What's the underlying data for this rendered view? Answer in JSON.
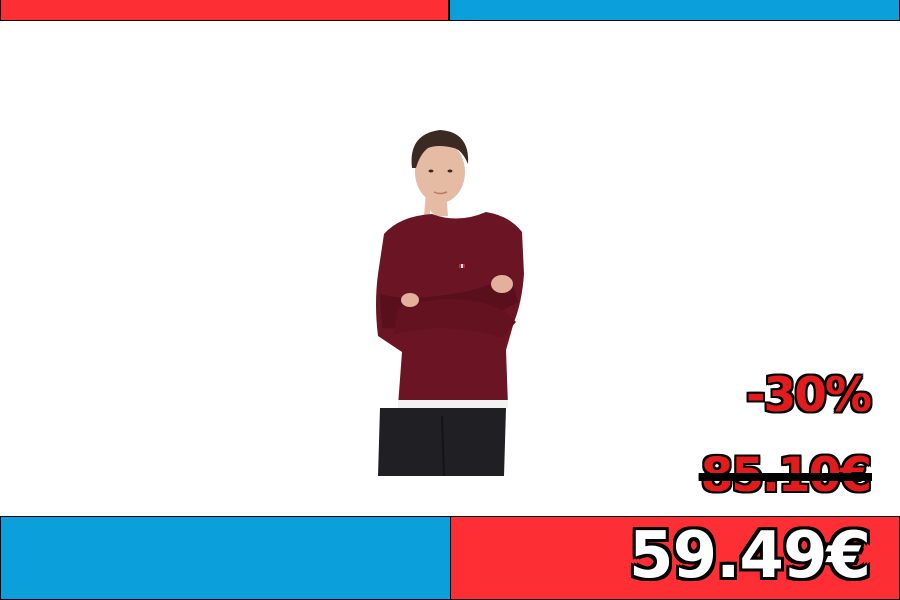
{
  "colors": {
    "red": "#fd2f35",
    "blue": "#0b9fdc",
    "sweater": "#6b1424",
    "trousers": "#1f1f24"
  },
  "product": {
    "image": "man-in-burgundy-crewneck-sweater"
  },
  "pricing": {
    "discount": "-30%",
    "old_price": "85.10€",
    "new_price": "59.49€"
  }
}
